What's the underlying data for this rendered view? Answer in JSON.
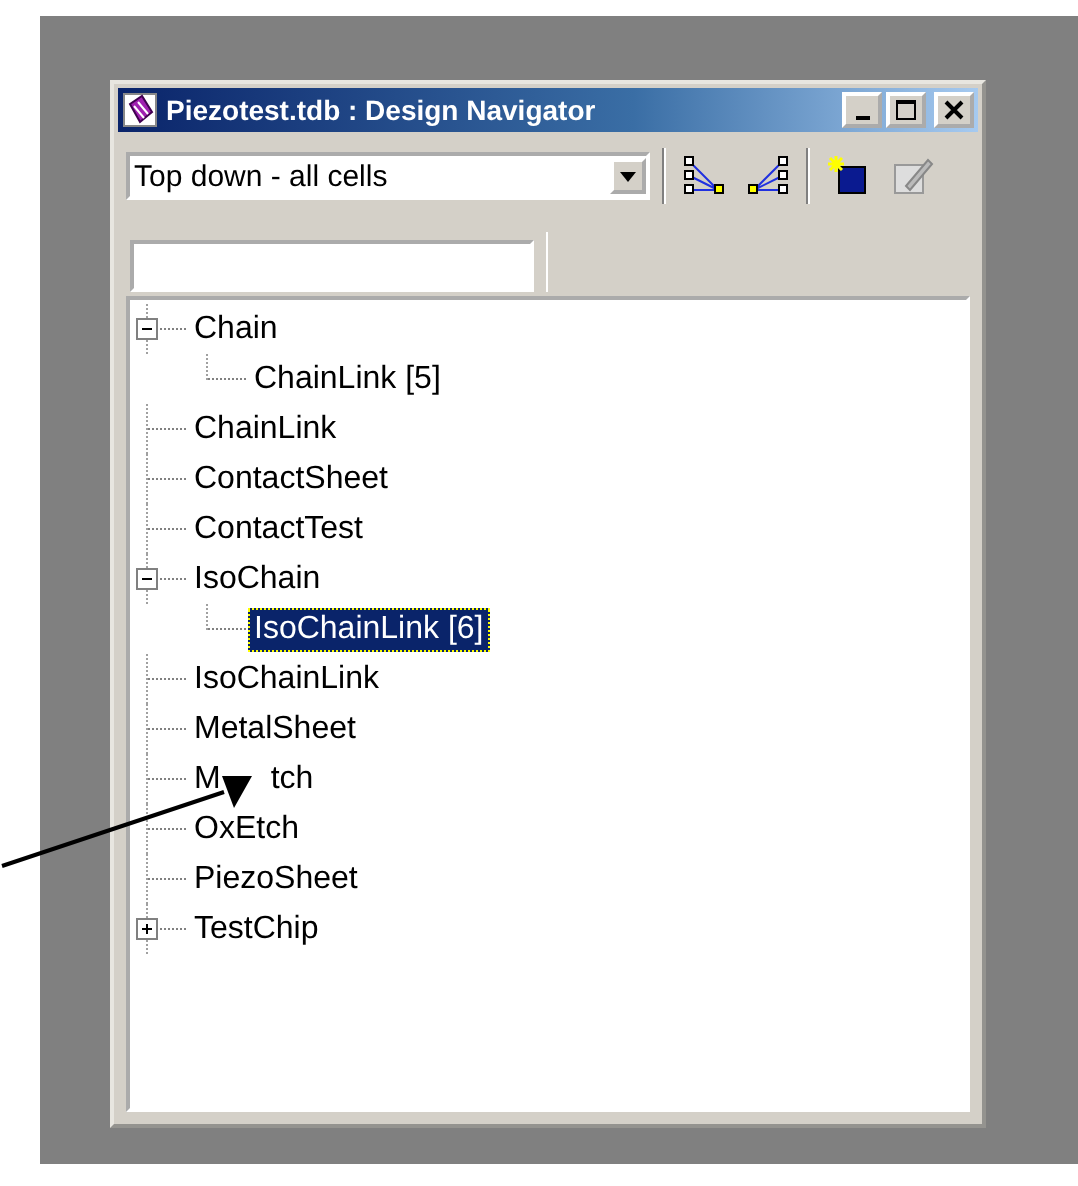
{
  "window": {
    "title": "Piezotest.tdb : Design Navigator"
  },
  "toolbar": {
    "view_select": {
      "value": "Top down - all cells"
    }
  },
  "tree": [
    {
      "label": "Chain",
      "expanded": true,
      "selected": false,
      "children": [
        {
          "label": "ChainLink [5]",
          "selected": false
        }
      ]
    },
    {
      "label": "ChainLink",
      "selected": false
    },
    {
      "label": "ContactSheet",
      "selected": false
    },
    {
      "label": "ContactTest",
      "selected": false
    },
    {
      "label": "IsoChain",
      "expanded": true,
      "selected": false,
      "children": [
        {
          "label": "IsoChainLink [6]",
          "selected": true
        }
      ]
    },
    {
      "label": "IsoChainLink",
      "selected": false
    },
    {
      "label": "MetalSheet",
      "selected": false
    },
    {
      "label": "M",
      "label_tail": "tch",
      "selected": false
    },
    {
      "label": "OxEtch",
      "selected": false
    },
    {
      "label": "PiezoSheet",
      "selected": false
    },
    {
      "label": "TestChip",
      "expanded": false,
      "selected": false
    }
  ]
}
